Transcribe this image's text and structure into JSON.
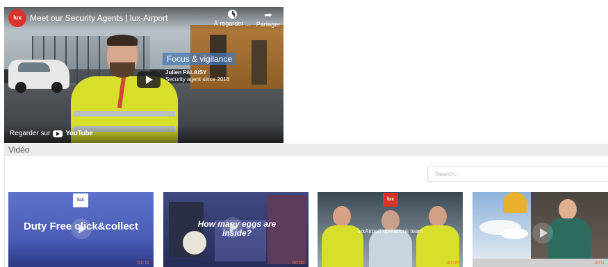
{
  "player": {
    "channel_logo": "lux",
    "title": "Meet our Security Agents | lux-Airport",
    "watch_later_label": "À regarder ...",
    "share_label": "Partager",
    "overlay_tag": "Focus & vigilance",
    "overlay_name": "Julien PALAISY",
    "overlay_role": "Security agent since 2018",
    "watch_on_label": "Regarder sur",
    "youtube_wordmark": "YouTube"
  },
  "gallery": {
    "title": "Vidéo",
    "search_placeholder": "Search...",
    "thumbnails": [
      {
        "logo": "lux",
        "title": "Duty Free click&collect",
        "duration": "01:11"
      },
      {
        "logo": "",
        "title": "How many eggs are inside?",
        "duration": "00:00"
      },
      {
        "logo": "lux",
        "title": "",
        "subtitle": "luxAirport operations team",
        "duration": "00:00"
      },
      {
        "logo": "",
        "title": "",
        "duration": "00:0"
      }
    ]
  },
  "colors": {
    "brand_red": "#d8332c",
    "thumb_blue": "#4a5db8",
    "duration_orange": "#ff6a3c"
  }
}
